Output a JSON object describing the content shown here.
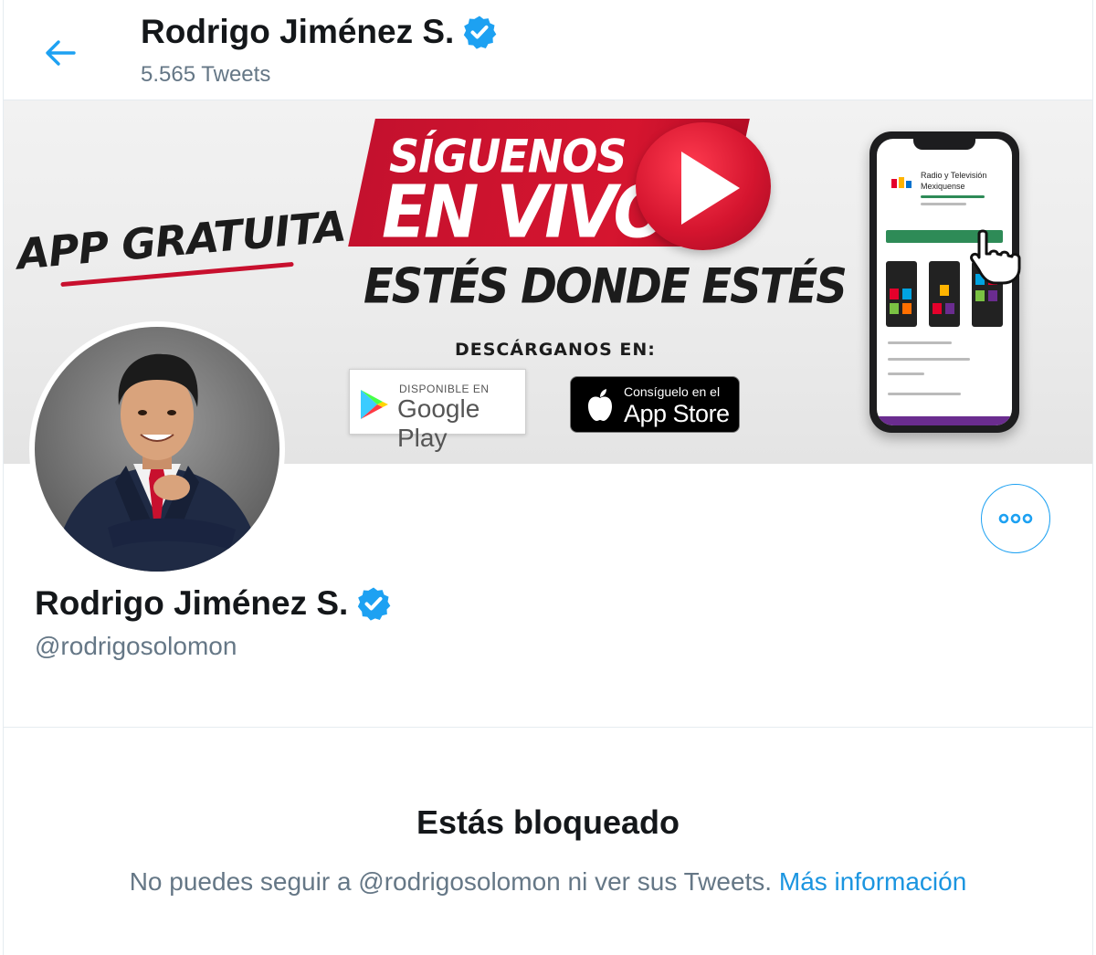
{
  "header": {
    "title": "Rodrigo Jiménez S.",
    "tweet_count": "5.565 Tweets"
  },
  "banner": {
    "app_gratuita": "APP GRATUITA",
    "siguenos": "SÍGUENOS",
    "en_vivo": "EN VIVO",
    "estes": "ESTÉS DONDE ESTÉS",
    "descarganos": "DESCÁRGANOS EN:",
    "google_small": "DISPONIBLE EN",
    "google_big": "Google Play",
    "apple_small": "Consíguelo en el",
    "apple_big": "App Store",
    "phone_title": "Radio y Televisión Mexiquense"
  },
  "profile": {
    "name": "Rodrigo Jiménez S.",
    "handle": "@rodrigosolomon"
  },
  "blocked": {
    "title": "Estás bloqueado",
    "message": "No puedes seguir a @rodrigosolomon ni ver sus Tweets.",
    "link": "Más información"
  },
  "colors": {
    "accent": "#1da1f2",
    "link": "#1b95e0",
    "muted": "#657786",
    "banner_red": "#d5152f"
  }
}
